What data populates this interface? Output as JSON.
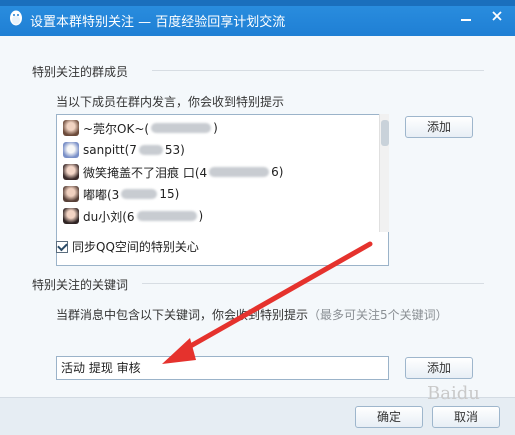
{
  "window": {
    "title": "设置本群特别关注 — 百度经验回享计划交流"
  },
  "members": {
    "section_title": "特别关注的群成员",
    "description": "当以下成员在群内发言，你会收到特别提示",
    "add_button": "添加",
    "items": [
      {
        "name_prefix": "~莞尔OK~(",
        "name_suffix": ")"
      },
      {
        "name_prefix": "sanpitt(7",
        "name_suffix": "53)"
      },
      {
        "name_prefix": "微笑掩盖不了泪痕 口(4",
        "name_suffix": "6)"
      },
      {
        "name_prefix": "嘟嘟(3",
        "name_suffix": "15)"
      },
      {
        "name_prefix": "du小刘(6",
        "name_suffix": ")"
      }
    ],
    "sync_label": "同步QQ空间的特别关心"
  },
  "keywords": {
    "section_title": "特别关注的关键词",
    "description": "当群消息中包含以下关键词，你会收到特别提示",
    "hint": "（最多可关注5个关键词）",
    "input_value": "活动 提现 审核",
    "add_button": "添加"
  },
  "footer": {
    "ok_button": "确定",
    "cancel_button": "取消"
  },
  "watermark": "Baidu"
}
